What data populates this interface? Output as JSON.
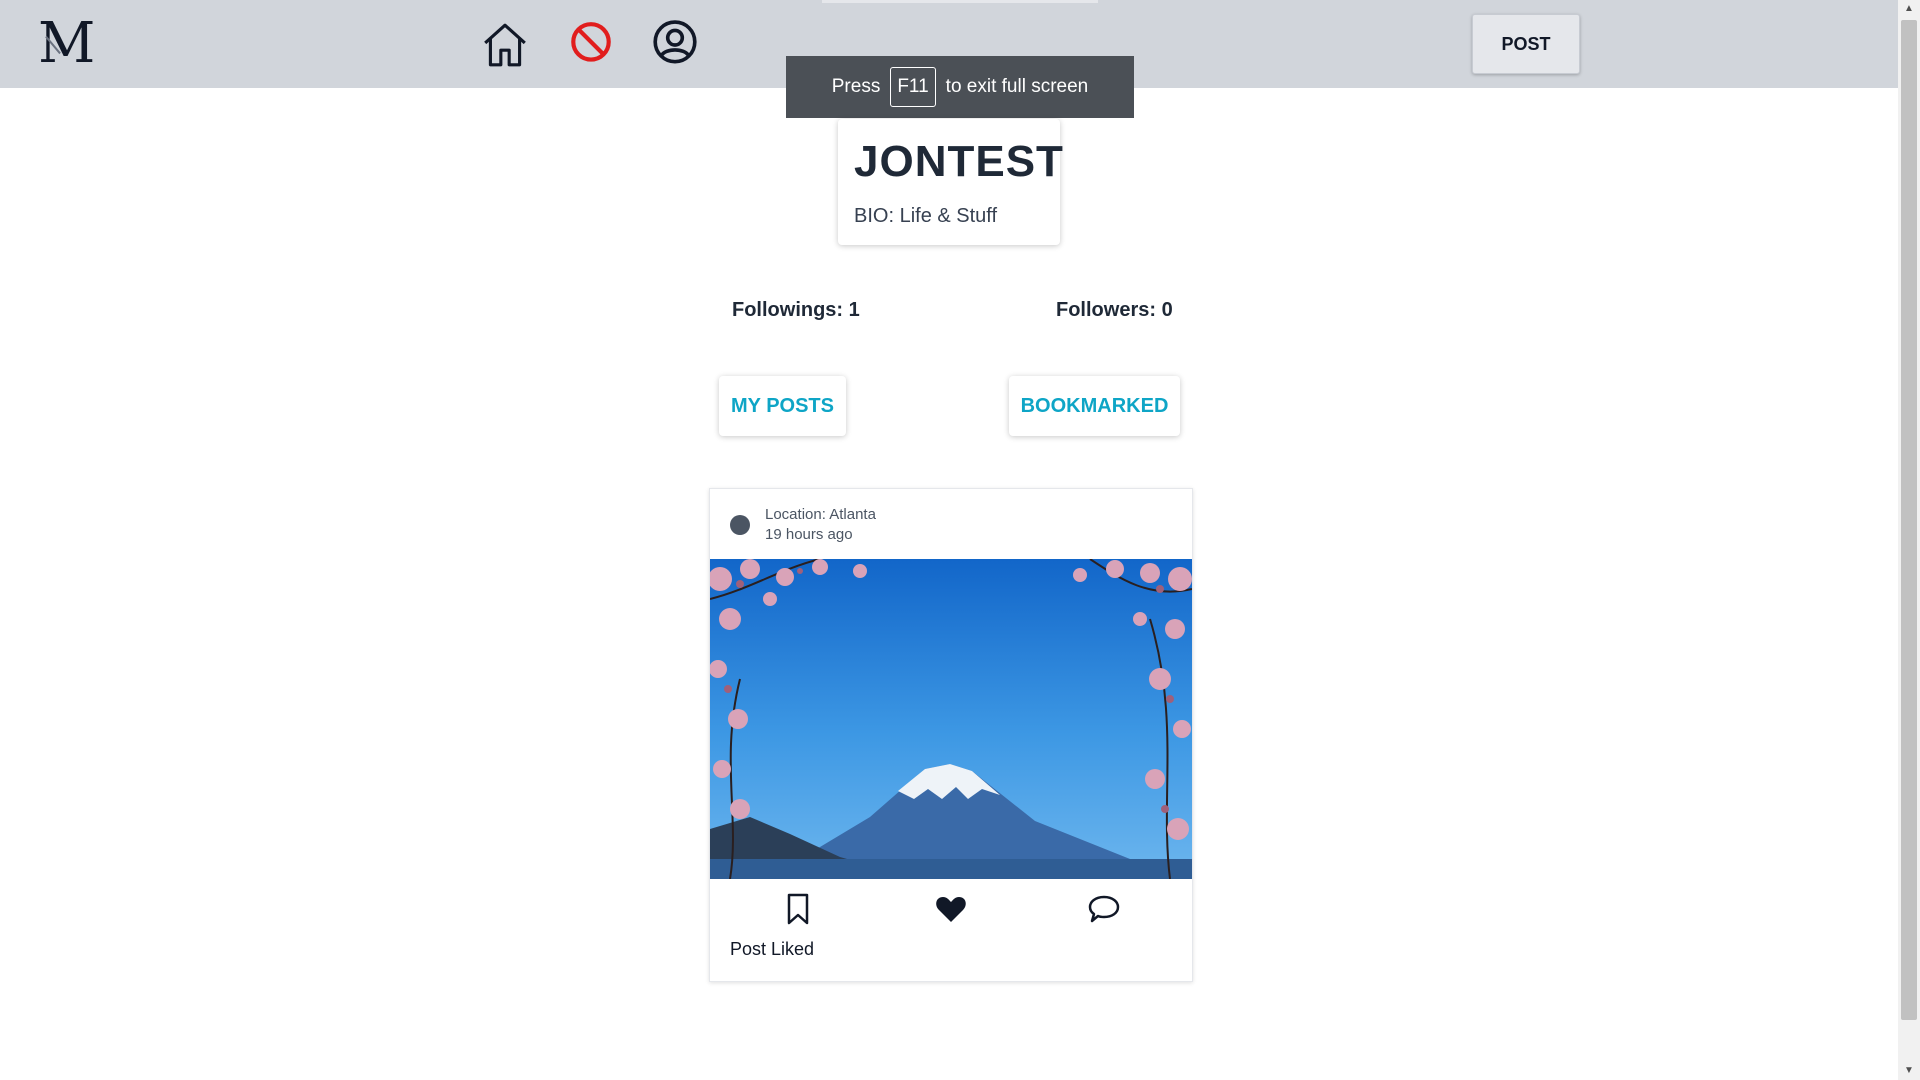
{
  "header": {
    "logo_text": "M",
    "post_button": "POST",
    "nav_icons": [
      "home-icon",
      "blocked-icon",
      "account-circle-icon"
    ]
  },
  "fullscreen_notice": {
    "prefix": "Press",
    "key": "F11",
    "suffix": "to exit full screen"
  },
  "profile": {
    "name": "JONTEST",
    "bio": "BIO: Life & Stuff"
  },
  "stats": {
    "followings": "Followings: 1",
    "followers": "Followers: 0"
  },
  "tabs": {
    "my_posts": "MY POSTS",
    "bookmarked": "BOOKMARKED"
  },
  "post": {
    "location": "Location: Atlanta",
    "time": "19 hours ago",
    "like_status": "Post Liked",
    "actions": [
      "bookmark-icon",
      "heart-icon",
      "comment-icon"
    ]
  },
  "colors": {
    "header_bg": "#d1d5db",
    "accent": "#0ea5c6",
    "blocked_icon": "#e11d1d",
    "text_dark": "#1f2937"
  }
}
